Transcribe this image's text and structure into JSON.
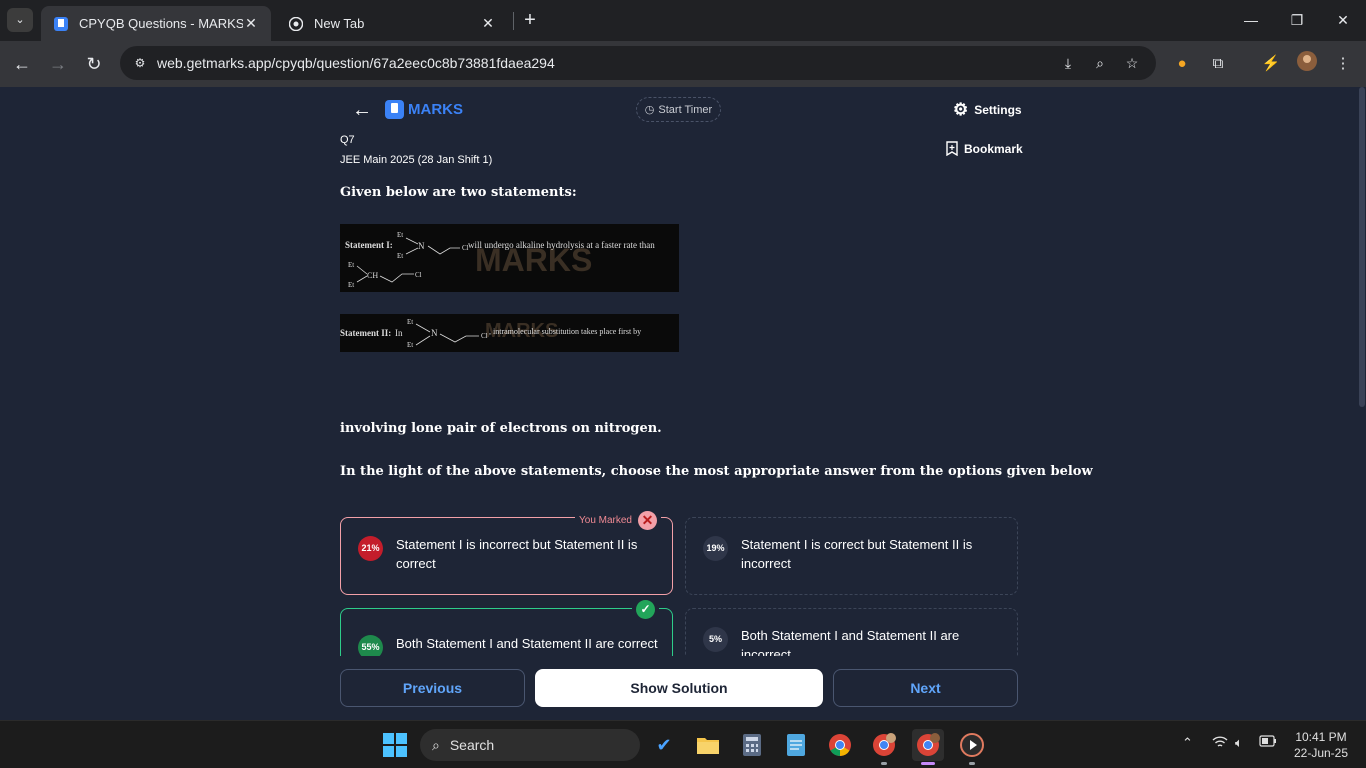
{
  "browser": {
    "tabs": [
      {
        "title": "CPYQB Questions - MARKS App",
        "active": true
      },
      {
        "title": "New Tab",
        "active": false
      }
    ],
    "url": "web.getmarks.app/cpyqb/question/67a2eec0c8b73881fdaea294"
  },
  "header": {
    "logo": "MARKS",
    "timer_label": "Start Timer",
    "settings_label": "Settings",
    "bookmark_label": "Bookmark"
  },
  "question": {
    "number": "Q7",
    "exam": "JEE Main 2025 (28 Jan Shift 1)",
    "intro": "Given below are two statements:",
    "image1": {
      "statement_label": "Statement I:",
      "text": "will undergo alkaline hydrolysis at a faster rate than",
      "watermark": "MARKS",
      "labels": {
        "et_top": "Et",
        "n": "N",
        "et_bottom": "Et",
        "cl": "Cl",
        "et_left_top": "Et",
        "ch": "CH",
        "et_left_bottom": "Et",
        "cl2": "Cl"
      }
    },
    "image2": {
      "statement_label": "Statement II:",
      "prefix": "In",
      "text": ", intramolecular substitution takes place first by",
      "watermark": "MARKS",
      "labels": {
        "et_top": "Et",
        "n": "N",
        "et_bottom": "Et",
        "cl": "Cl"
      }
    },
    "continuation": "involving lone pair of electrons on nitrogen.",
    "instruction": "In the light of the above statements, choose the most appropriate answer from the options given below"
  },
  "options": [
    {
      "percent": "21%",
      "text": "Statement I is incorrect but Statement II is correct",
      "state": "marked-wrong"
    },
    {
      "percent": "19%",
      "text": "Statement I is correct but Statement II is incorrect",
      "state": "neutral"
    },
    {
      "percent": "55%",
      "text": "Both Statement I and Statement II are correct",
      "state": "correct"
    },
    {
      "percent": "5%",
      "text": "Both Statement I and Statement II are incorrect",
      "state": "neutral"
    }
  ],
  "you_marked_label": "You Marked",
  "footer": {
    "previous": "Previous",
    "show_solution": "Show Solution",
    "next": "Next"
  },
  "taskbar": {
    "search_label": "Search",
    "time": "10:41 PM",
    "date": "22-Jun-25"
  },
  "colors": {
    "page_bg": "#1e2536",
    "accent": "#3b82f6",
    "wrong": "#f3a0a8",
    "correct": "#2ecc8a"
  }
}
